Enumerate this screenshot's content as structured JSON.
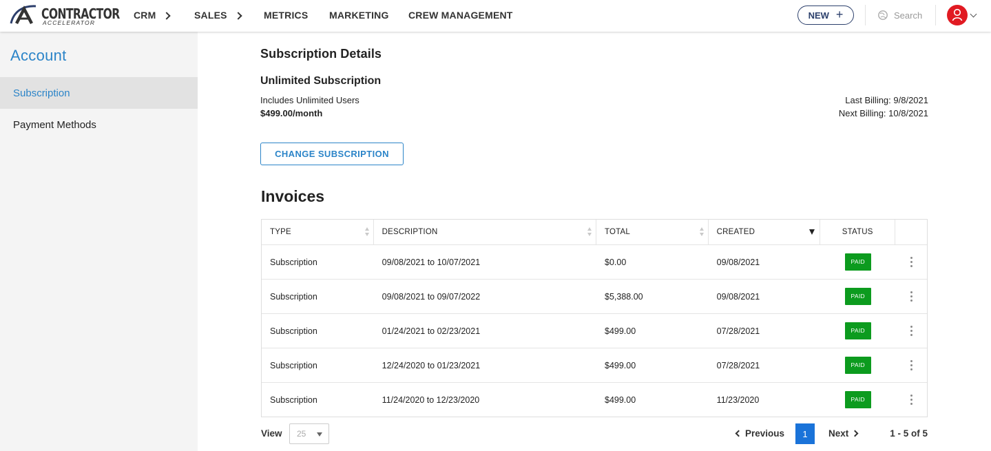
{
  "brand": {
    "line1": "CONTRACTOR",
    "line2": "ACCELERATOR"
  },
  "nav": [
    {
      "label": "CRM",
      "has_chevron": true
    },
    {
      "label": "SALES",
      "has_chevron": true
    },
    {
      "label": "METRICS",
      "has_chevron": false
    },
    {
      "label": "MARKETING",
      "has_chevron": false
    },
    {
      "label": "CREW MANAGEMENT",
      "has_chevron": false
    }
  ],
  "header_actions": {
    "new_label": "NEW",
    "new_icon": "plus-icon",
    "search_placeholder": "Search",
    "avatar_icon": "user-icon",
    "accent": "#e11a22"
  },
  "sidebar": {
    "title": "Account",
    "items": [
      {
        "label": "Subscription",
        "active": true
      },
      {
        "label": "Payment Methods",
        "active": false
      }
    ]
  },
  "subscription": {
    "heading": "Subscription Details",
    "plan_name": "Unlimited Subscription",
    "plan_users": "Includes Unlimited Users",
    "price": "$499.00/month",
    "last_billing": "Last Billing: 9/8/2021",
    "next_billing": "Next Billing: 10/8/2021",
    "change_label": "CHANGE SUBSCRIPTION"
  },
  "invoices": {
    "heading": "Invoices",
    "columns": [
      "TYPE",
      "DESCRIPTION",
      "TOTAL",
      "CREATED",
      "STATUS"
    ],
    "sorted_column": "CREATED",
    "sort_direction": "descending",
    "rows": [
      {
        "type": "Subscription",
        "description": "09/08/2021 to 10/07/2021",
        "total": "$0.00",
        "created": "09/08/2021",
        "status": "PAID"
      },
      {
        "type": "Subscription",
        "description": "09/08/2021 to 09/07/2022",
        "total": "$5,388.00",
        "created": "09/08/2021",
        "status": "PAID"
      },
      {
        "type": "Subscription",
        "description": "01/24/2021 to 02/23/2021",
        "total": "$499.00",
        "created": "07/28/2021",
        "status": "PAID"
      },
      {
        "type": "Subscription",
        "description": "12/24/2020 to 01/23/2021",
        "total": "$499.00",
        "created": "07/28/2021",
        "status": "PAID"
      },
      {
        "type": "Subscription",
        "description": "11/24/2020 to 12/23/2020",
        "total": "$499.00",
        "created": "11/23/2020",
        "status": "PAID"
      }
    ],
    "status_color": "#0c9b1e"
  },
  "pagination": {
    "view_label": "View",
    "page_size": "25",
    "prev_label": "Previous",
    "next_label": "Next",
    "current_page": "1",
    "range": "1 - 5 of 5"
  }
}
